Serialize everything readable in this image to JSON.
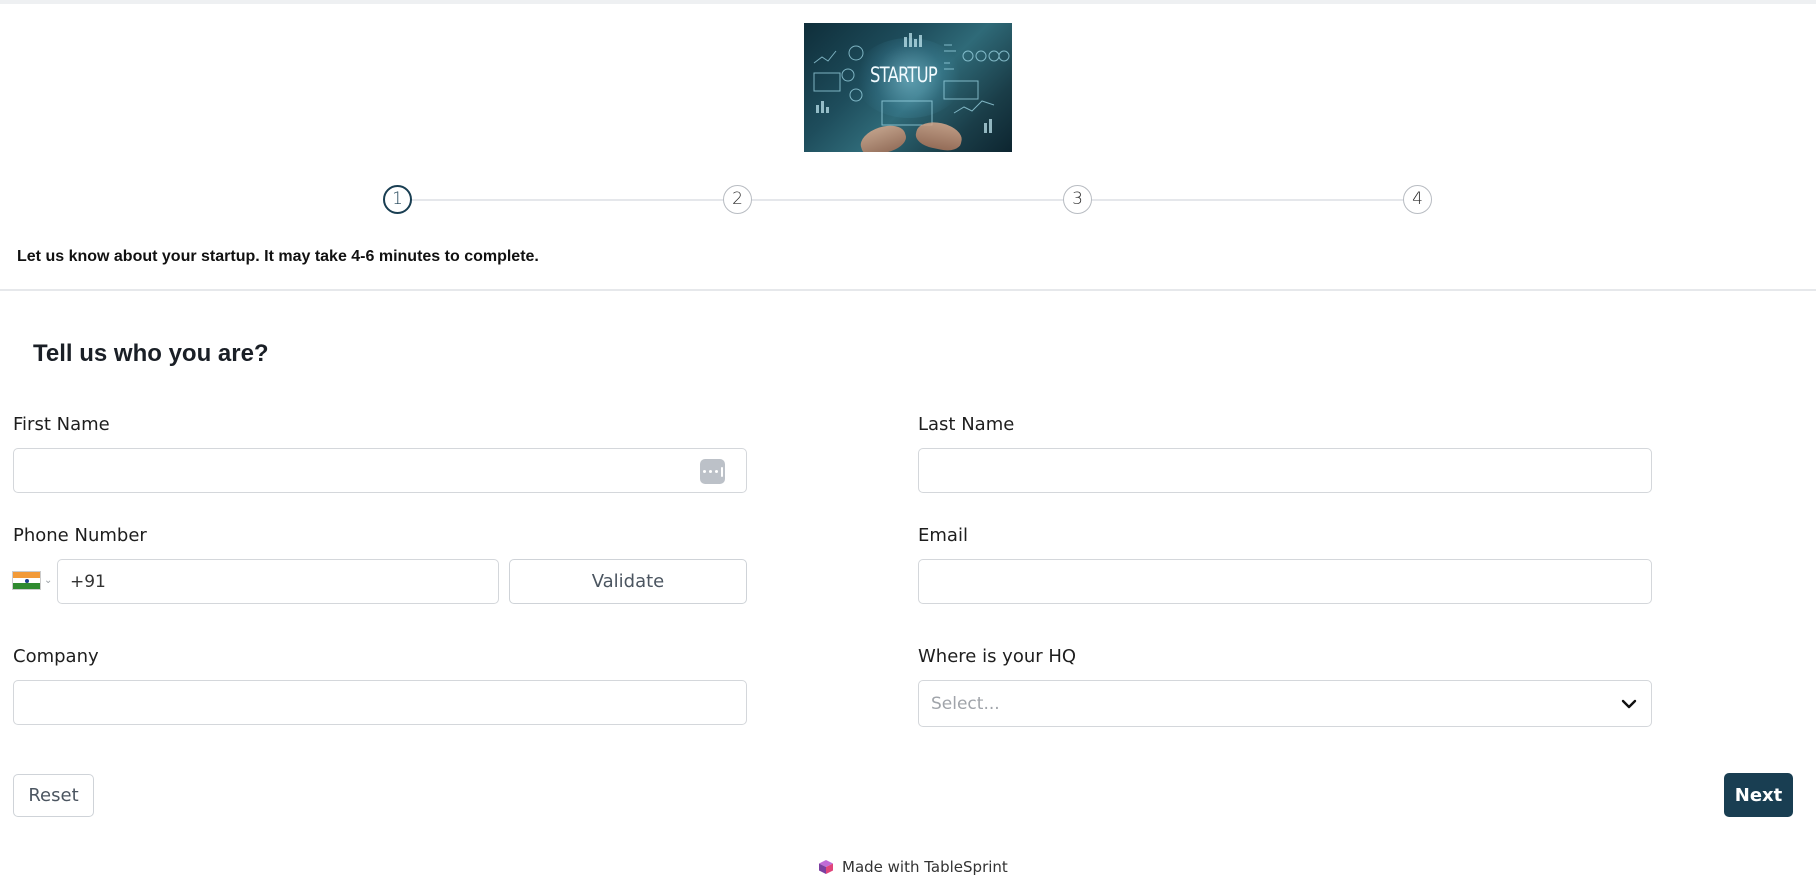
{
  "banner": {
    "text": "STARTUP"
  },
  "stepper": {
    "steps": [
      "1",
      "2",
      "3",
      "4"
    ],
    "active_step": 1
  },
  "intro": "Let us know about your startup. It may take 4-6 minutes to complete.",
  "form": {
    "title": "Tell us who you are?",
    "first_name": {
      "label": "First Name",
      "value": ""
    },
    "last_name": {
      "label": "Last Name",
      "value": ""
    },
    "phone": {
      "label": "Phone Number",
      "country": "India",
      "value": "+91",
      "validate_label": "Validate"
    },
    "email": {
      "label": "Email",
      "value": ""
    },
    "company": {
      "label": "Company",
      "value": ""
    },
    "hq": {
      "label": "Where is your HQ",
      "placeholder": "Select..."
    }
  },
  "actions": {
    "reset_label": "Reset",
    "next_label": "Next"
  },
  "footer": {
    "text": "Made with TableSprint"
  },
  "colors": {
    "primary": "#193e52",
    "border": "#d4d7db",
    "flag_saffron": "#f29a38",
    "flag_green": "#2f8a2f"
  },
  "icons": [
    "password-manager-icon",
    "india-flag-icon",
    "chevron-down-icon",
    "tablesprint-logo-icon"
  ]
}
